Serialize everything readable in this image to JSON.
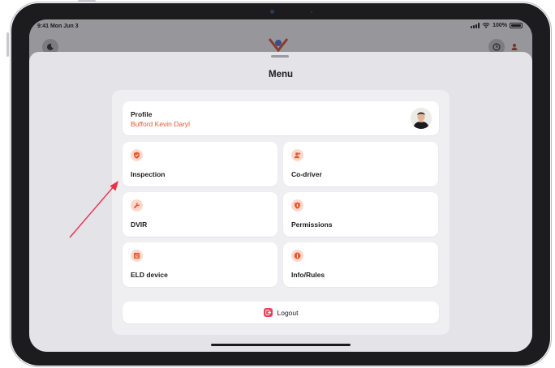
{
  "status_bar": {
    "time": "9:41 Mon Jun 3",
    "battery": "100%"
  },
  "menu": {
    "title": "Menu",
    "profile": {
      "title": "Profile",
      "name": "Bufford Kevin Daryl"
    },
    "items": [
      {
        "label": "Inspection",
        "icon": "shield-check-icon"
      },
      {
        "label": "Co-driver",
        "icon": "person-add-icon"
      },
      {
        "label": "DVIR",
        "icon": "wrench-icon"
      },
      {
        "label": "Permissions",
        "icon": "lock-shield-icon"
      },
      {
        "label": "ELD device",
        "icon": "wifi-device-icon"
      },
      {
        "label": "Info/Rules",
        "icon": "info-icon"
      }
    ],
    "logout": {
      "label": "Logout",
      "icon": "logout-icon"
    }
  },
  "colors": {
    "accent": "#e8572f",
    "icon_bg": "#fbd9cc",
    "logout": "#e8425a",
    "annotation_arrow": "#e8334a"
  }
}
